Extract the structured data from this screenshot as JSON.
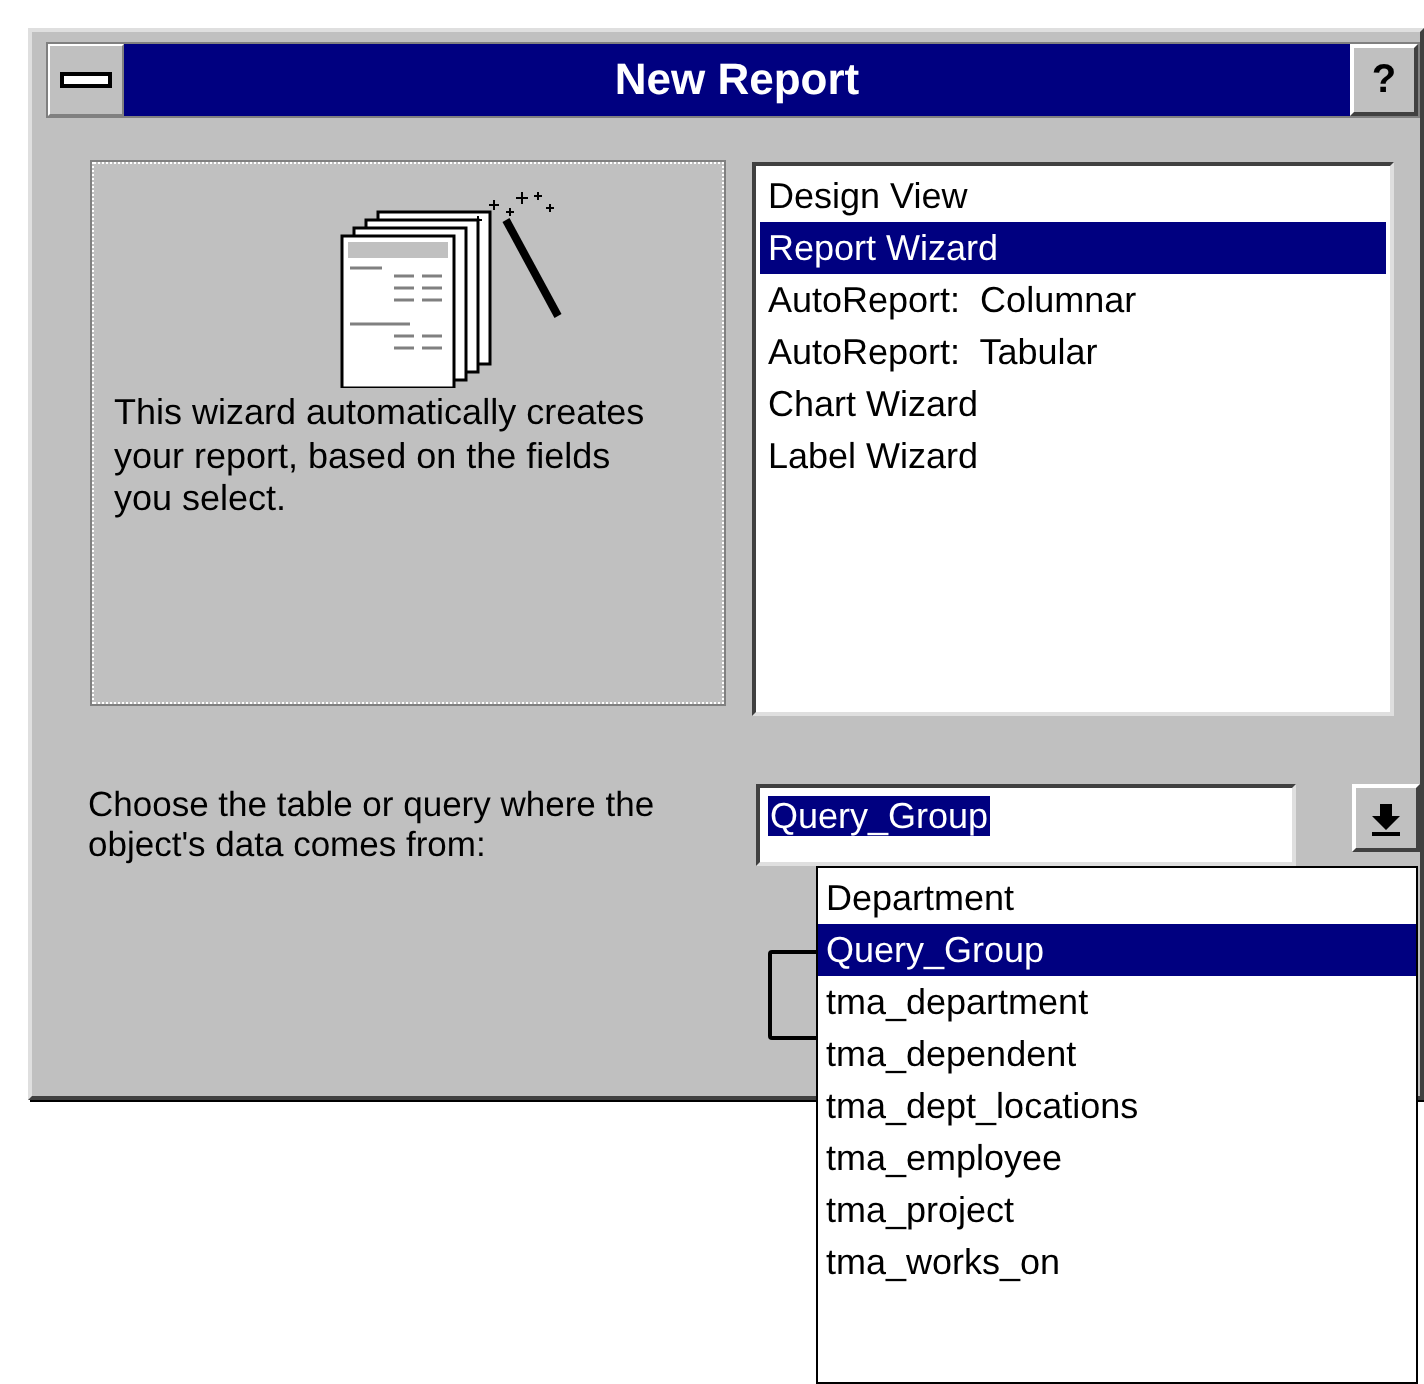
{
  "window": {
    "title": "New Report",
    "help_button": "?"
  },
  "description": "This wizard automatically creates your report, based on the fields you select.",
  "options": [
    {
      "label": "Design View",
      "selected": false
    },
    {
      "label": "Report Wizard",
      "selected": true
    },
    {
      "label": "AutoReport:  Columnar",
      "selected": false
    },
    {
      "label": "AutoReport:  Tabular",
      "selected": false
    },
    {
      "label": "Chart Wizard",
      "selected": false
    },
    {
      "label": "Label Wizard",
      "selected": false
    }
  ],
  "source": {
    "label": "Choose the table or query where the object's data comes from:",
    "value": "Query_Group",
    "dropdown_items": [
      {
        "label": "Department",
        "selected": false
      },
      {
        "label": "Query_Group",
        "selected": true
      },
      {
        "label": "tma_department",
        "selected": false
      },
      {
        "label": "tma_dependent",
        "selected": false
      },
      {
        "label": "tma_dept_locations",
        "selected": false
      },
      {
        "label": "tma_employee",
        "selected": false
      },
      {
        "label": "tma_project",
        "selected": false
      },
      {
        "label": "tma_works_on",
        "selected": false
      }
    ]
  }
}
